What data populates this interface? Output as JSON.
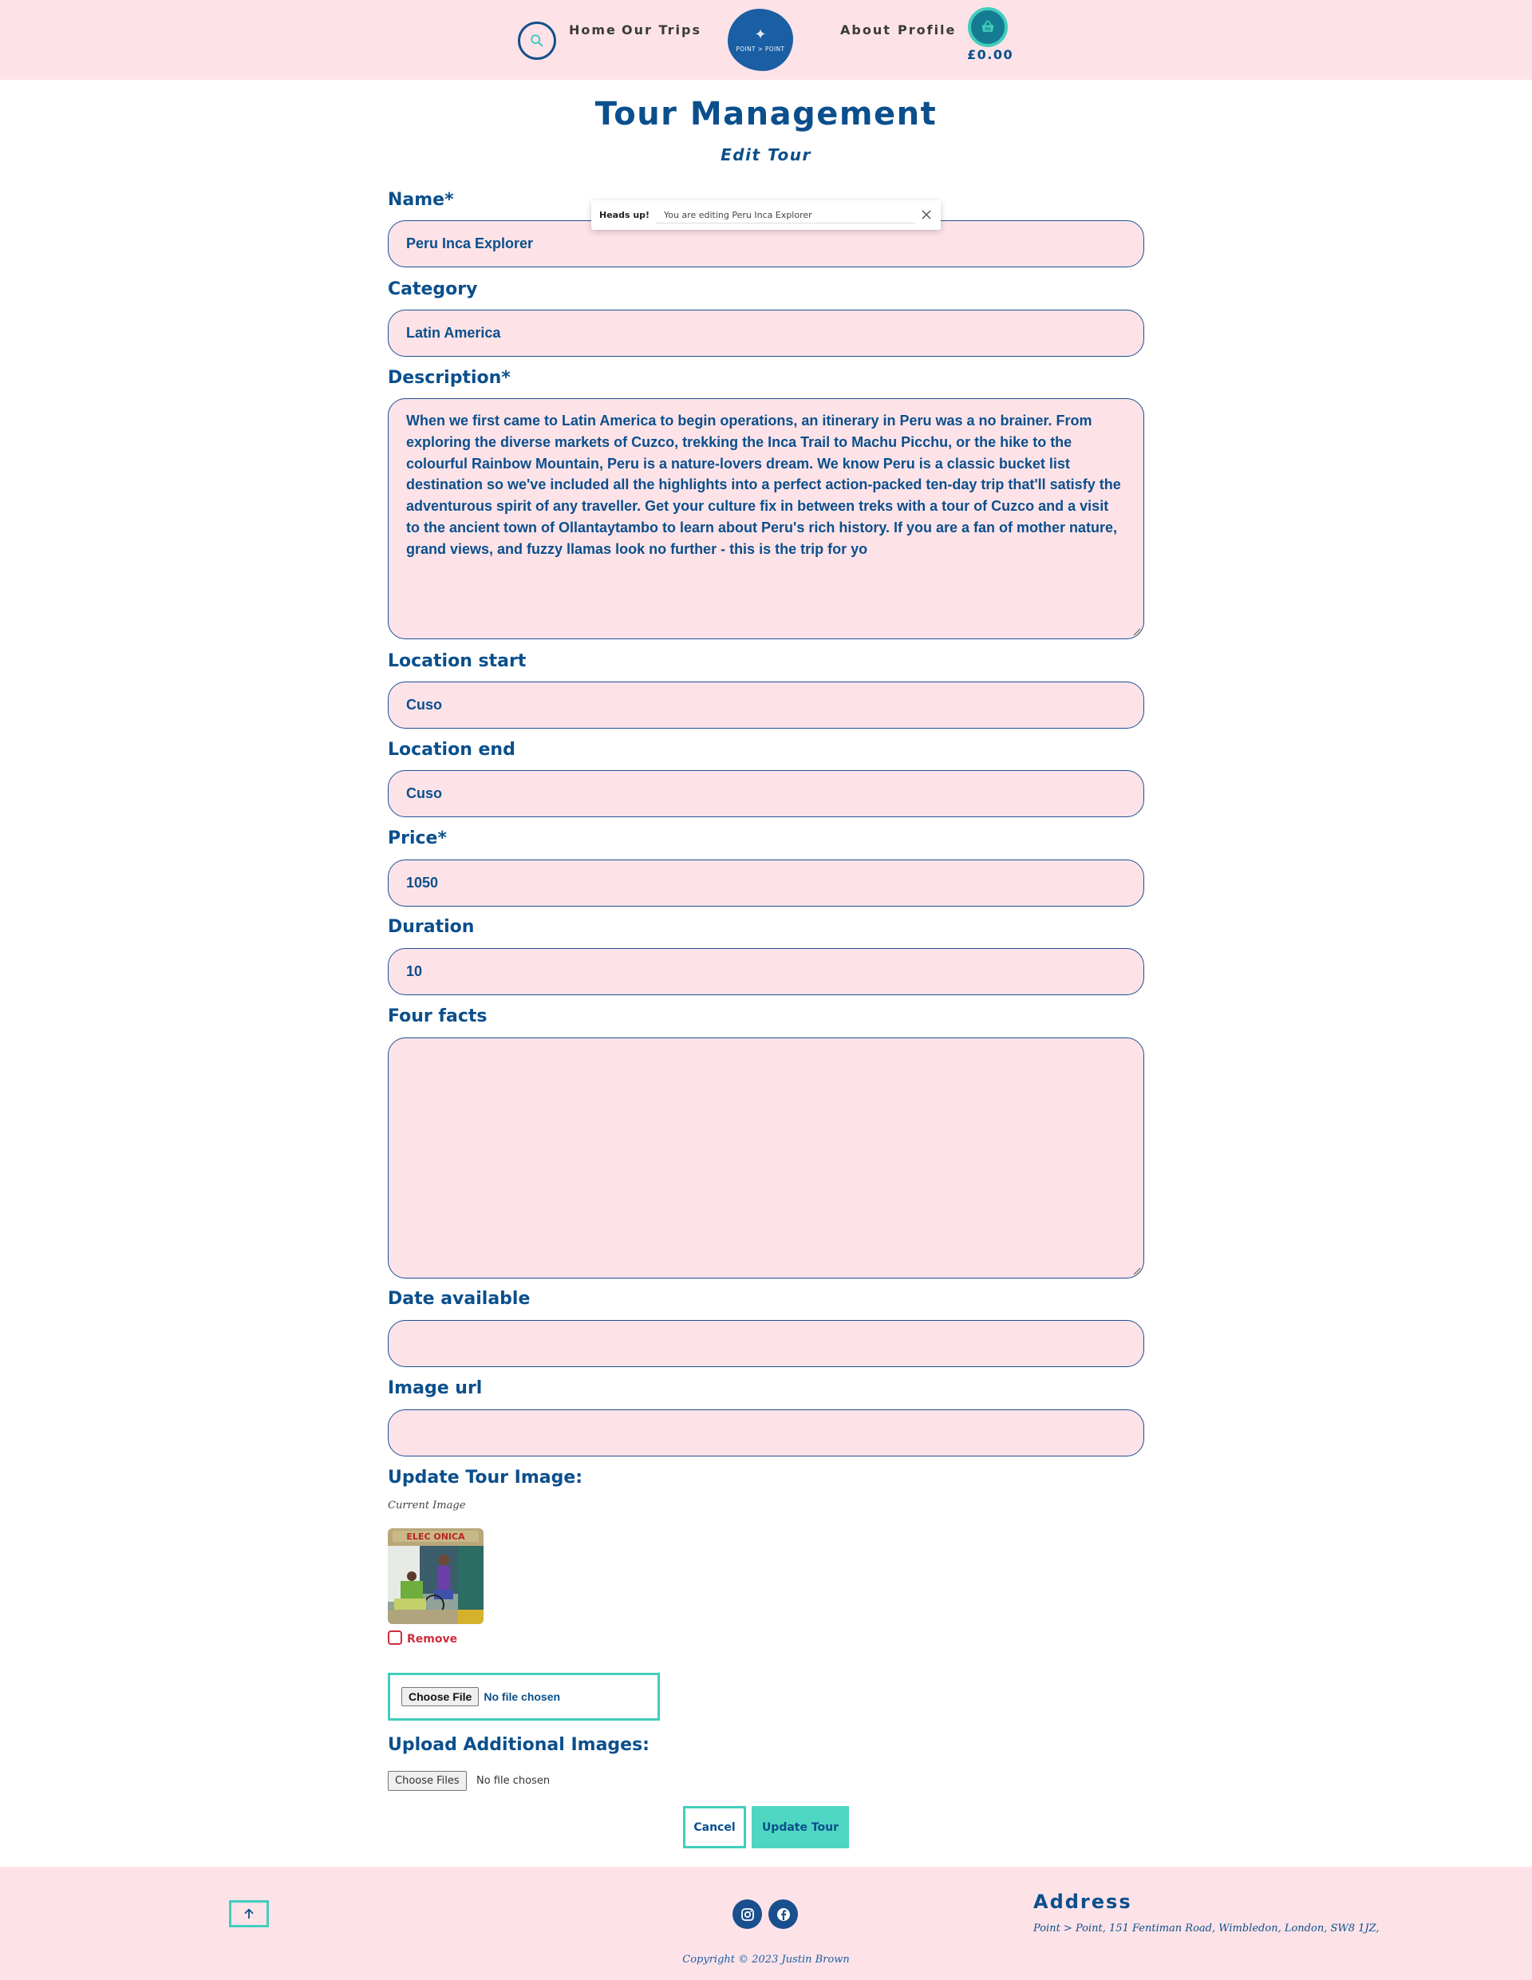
{
  "header": {
    "nav_left": [
      "Home",
      "Our Trips"
    ],
    "nav_right": [
      "About",
      "Profile"
    ],
    "logo_text": "POINT > POINT",
    "basket_total": "£0.00"
  },
  "page": {
    "title": "Tour Management",
    "subtitle": "Edit Tour"
  },
  "toast": {
    "heading": "Heads up!",
    "message": "You are editing Peru Inca Explorer"
  },
  "form": {
    "name_label": "Name*",
    "name_value": "Peru Inca Explorer",
    "category_label": "Category",
    "category_value": "Latin America",
    "description_label": "Description*",
    "description_value": "When we first came to Latin America to begin operations, an itinerary in Peru was a no brainer. From exploring the diverse markets of Cuzco, trekking the Inca Trail to Machu Picchu, or the hike to the colourful Rainbow Mountain, Peru is a nature-lovers dream. We know Peru is a classic bucket list destination so we've included all the highlights into a perfect action-packed ten-day trip that'll satisfy the adventurous spirit of any traveller. Get your culture fix in between treks with a tour of Cuzco and a visit to the ancient town of Ollantaytambo to learn about Peru's rich history. If you are a fan of mother nature, grand views, and fuzzy llamas look no further - this is the trip for yo",
    "location_start_label": "Location start",
    "location_start_value": "Cuso",
    "location_end_label": "Location end",
    "location_end_value": "Cuso",
    "price_label": "Price*",
    "price_value": "1050",
    "duration_label": "Duration",
    "duration_value": "10",
    "four_facts_label": "Four facts",
    "four_facts_value": "",
    "date_available_label": "Date available",
    "date_available_value": "",
    "image_url_label": "Image url",
    "image_url_value": "",
    "update_image_label": "Update Tour Image:",
    "current_image_label": "Current Image",
    "remove_label": "Remove",
    "choose_file_label": "Choose File",
    "no_file_label": "No file chosen",
    "additional_images_label": "Upload Additional Images:",
    "choose_files_label": "Choose Files",
    "no_files_label": "No file chosen",
    "cancel_label": "Cancel",
    "update_label": "Update Tour"
  },
  "footer": {
    "address_title": "Address",
    "address_text": "Point > Point, 151 Fentiman Road, Wimbledon, London, SW8 1JZ,",
    "copyright": "Copyright © 2023 Justin Brown"
  },
  "colors": {
    "brand_blue": "#0b4f8c",
    "accent_teal": "#42cdbd",
    "pink_bg": "#fde3e8",
    "danger_red": "#cf2b3c"
  },
  "icons": [
    "search-icon",
    "compass-icon",
    "basket-icon",
    "close-icon",
    "arrow-up-icon",
    "instagram-icon",
    "facebook-icon"
  ]
}
